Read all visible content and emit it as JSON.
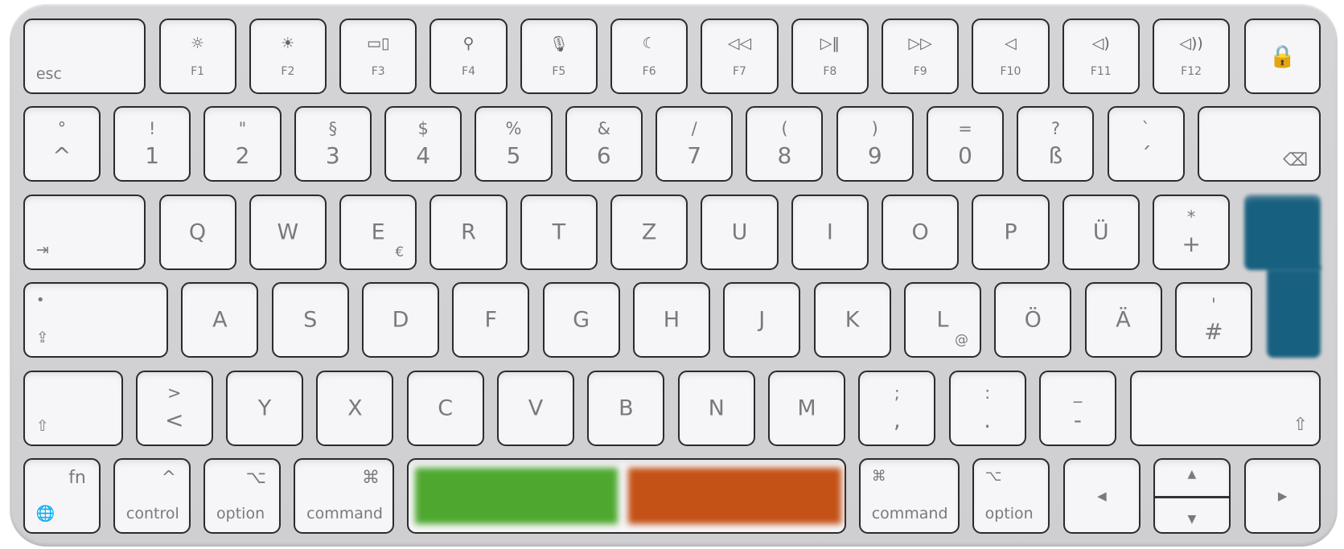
{
  "keyboard": {
    "highlight_colors": {
      "return": "#17607f",
      "space_left": "#4ea82f",
      "space_right": "#c45116"
    },
    "rows": [
      [
        {
          "type": "word-bl",
          "label": "esc"
        },
        {
          "type": "fkey",
          "icon": "brightness-down-icon",
          "label": "F1"
        },
        {
          "type": "fkey",
          "icon": "brightness-up-icon",
          "label": "F2"
        },
        {
          "type": "fkey",
          "icon": "mission-control-icon",
          "label": "F3"
        },
        {
          "type": "fkey",
          "icon": "search-icon",
          "label": "F4"
        },
        {
          "type": "fkey",
          "icon": "microphone-icon",
          "label": "F5"
        },
        {
          "type": "fkey",
          "icon": "moon-icon",
          "label": "F6"
        },
        {
          "type": "fkey",
          "icon": "rewind-icon",
          "label": "F7"
        },
        {
          "type": "fkey",
          "icon": "play-pause-icon",
          "label": "F8"
        },
        {
          "type": "fkey",
          "icon": "fast-forward-icon",
          "label": "F9"
        },
        {
          "type": "fkey",
          "icon": "mute-icon",
          "label": "F10"
        },
        {
          "type": "fkey",
          "icon": "volume-down-icon",
          "label": "F11"
        },
        {
          "type": "fkey",
          "icon": "volume-up-icon",
          "label": "F12"
        },
        {
          "type": "icon-center",
          "icon": "lock-icon"
        }
      ],
      [
        {
          "type": "two",
          "top": "°",
          "bottom": "^"
        },
        {
          "type": "two",
          "top": "!",
          "bottom": "1"
        },
        {
          "type": "two",
          "top": "\"",
          "bottom": "2"
        },
        {
          "type": "two",
          "top": "§",
          "bottom": "3"
        },
        {
          "type": "two",
          "top": "$",
          "bottom": "4"
        },
        {
          "type": "two",
          "top": "%",
          "bottom": "5"
        },
        {
          "type": "two",
          "top": "&",
          "bottom": "6"
        },
        {
          "type": "two",
          "top": "/",
          "bottom": "7"
        },
        {
          "type": "two",
          "top": "(",
          "bottom": "8"
        },
        {
          "type": "two",
          "top": ")",
          "bottom": "9"
        },
        {
          "type": "two",
          "top": "=",
          "bottom": "0"
        },
        {
          "type": "two",
          "top": "?",
          "bottom": "ß"
        },
        {
          "type": "two",
          "top": "`",
          "bottom": "´"
        },
        {
          "type": "icon-br",
          "icon": "delete-icon"
        }
      ],
      [
        {
          "type": "icon-bl",
          "icon": "tab-icon"
        },
        {
          "type": "letter",
          "label": "Q"
        },
        {
          "type": "letter",
          "label": "W"
        },
        {
          "type": "letter",
          "label": "E",
          "sub": "€"
        },
        {
          "type": "letter",
          "label": "R"
        },
        {
          "type": "letter",
          "label": "T"
        },
        {
          "type": "letter",
          "label": "Z"
        },
        {
          "type": "letter",
          "label": "U"
        },
        {
          "type": "letter",
          "label": "I"
        },
        {
          "type": "letter",
          "label": "O"
        },
        {
          "type": "letter",
          "label": "P"
        },
        {
          "type": "letter",
          "label": "Ü"
        },
        {
          "type": "two",
          "top": "*",
          "bottom": "+"
        },
        {
          "type": "return"
        }
      ],
      [
        {
          "type": "caps",
          "icon": "caps-lock-icon"
        },
        {
          "type": "letter",
          "label": "A"
        },
        {
          "type": "letter",
          "label": "S"
        },
        {
          "type": "letter",
          "label": "D"
        },
        {
          "type": "letter",
          "label": "F"
        },
        {
          "type": "letter",
          "label": "G"
        },
        {
          "type": "letter",
          "label": "H"
        },
        {
          "type": "letter",
          "label": "J"
        },
        {
          "type": "letter",
          "label": "K"
        },
        {
          "type": "letter",
          "label": "L",
          "sub": "@"
        },
        {
          "type": "letter",
          "label": "Ö"
        },
        {
          "type": "letter",
          "label": "Ä"
        },
        {
          "type": "two",
          "top": "'",
          "bottom": "#"
        }
      ],
      [
        {
          "type": "icon-bl",
          "icon": "shift-icon"
        },
        {
          "type": "two",
          "top": ">",
          "bottom": "<"
        },
        {
          "type": "letter",
          "label": "Y"
        },
        {
          "type": "letter",
          "label": "X"
        },
        {
          "type": "letter",
          "label": "C"
        },
        {
          "type": "letter",
          "label": "V"
        },
        {
          "type": "letter",
          "label": "B"
        },
        {
          "type": "letter",
          "label": "N"
        },
        {
          "type": "letter",
          "label": "M"
        },
        {
          "type": "two",
          "top": ";",
          "bottom": ","
        },
        {
          "type": "two",
          "top": ":",
          "bottom": "."
        },
        {
          "type": "two",
          "top": "_",
          "bottom": "-"
        },
        {
          "type": "icon-br",
          "icon": "shift-icon"
        }
      ],
      [
        {
          "type": "fn",
          "label": "fn",
          "icon": "globe-icon"
        },
        {
          "type": "mod",
          "label": "control",
          "icon": "control-icon"
        },
        {
          "type": "mod",
          "label": "option",
          "icon": "option-icon"
        },
        {
          "type": "mod-r",
          "label": "command",
          "icon": "command-icon"
        },
        {
          "type": "space"
        },
        {
          "type": "mod-l",
          "label": "command",
          "icon": "command-icon"
        },
        {
          "type": "mod-l",
          "label": "option",
          "icon": "option-icon"
        },
        {
          "type": "arrow",
          "icon": "arrow-left-icon"
        },
        {
          "type": "updown",
          "icon_up": "arrow-up-icon",
          "icon_down": "arrow-down-icon"
        },
        {
          "type": "arrow",
          "icon": "arrow-right-icon"
        }
      ]
    ]
  }
}
